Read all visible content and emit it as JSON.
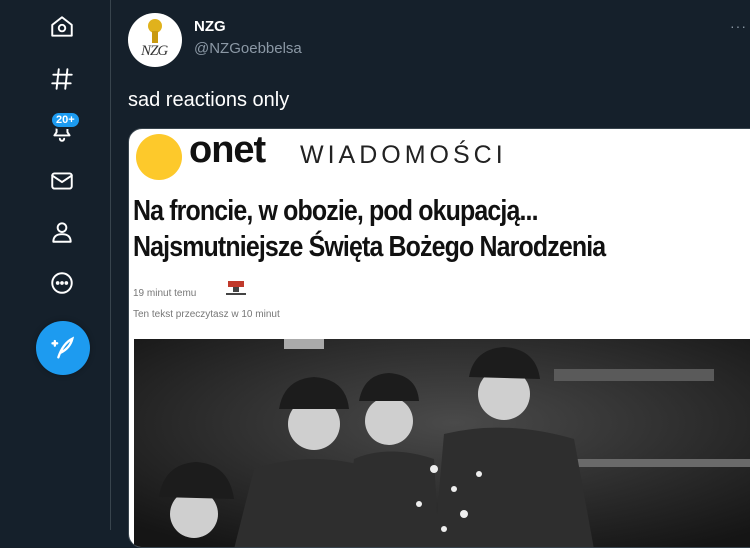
{
  "sidebar": {
    "items": [
      {
        "icon": "home-icon"
      },
      {
        "icon": "hashtag-icon"
      },
      {
        "icon": "bell-icon",
        "badge": "20+"
      },
      {
        "icon": "mail-icon"
      },
      {
        "icon": "profile-icon"
      },
      {
        "icon": "more-circle-icon"
      }
    ],
    "compose_icon": "feather-plus-icon"
  },
  "tweet": {
    "display_name": "NZG",
    "handle": "@NZGoebbelsa",
    "text": "sad reactions only",
    "more": "···",
    "avatar_letters": "NZG"
  },
  "article": {
    "brand": "onet",
    "section": "WIADOMOŚCI",
    "headline_line1": "Na froncie, w obozie, pod okupacją...",
    "headline_line2": "Najsmutniejsze Święta Bożego Narodzenia",
    "time": "19 minut temu",
    "read_time": "Ten tekst przeczytasz w 10 minut"
  },
  "colors": {
    "background": "#15202b",
    "accent": "#1d9bf0",
    "onet_yellow": "#fdc92b"
  }
}
